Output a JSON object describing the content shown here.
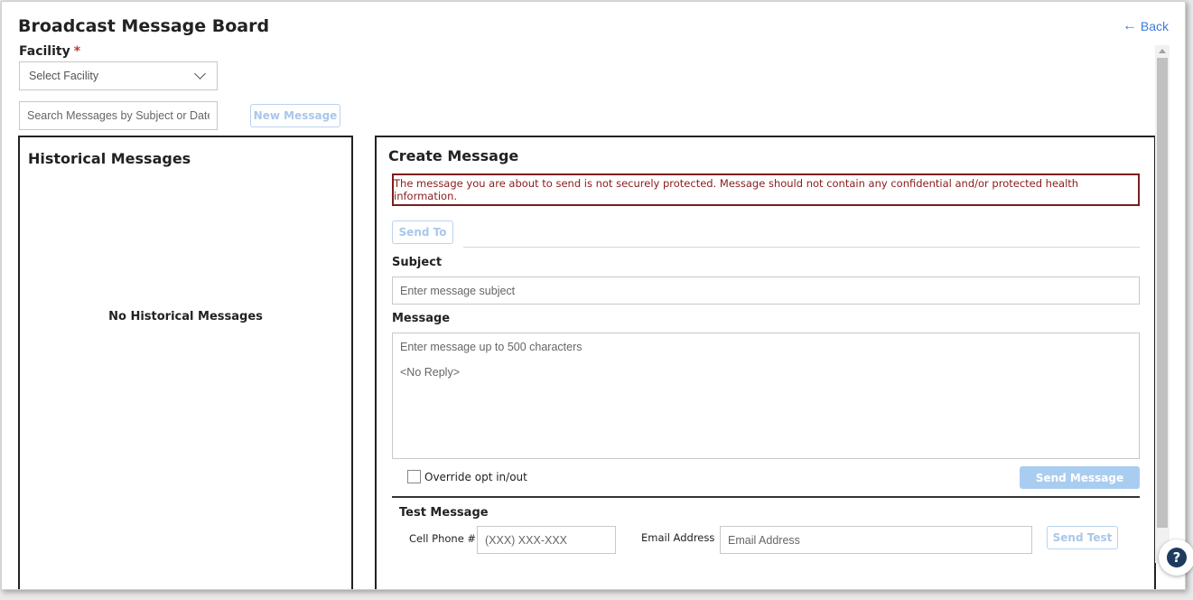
{
  "header": {
    "title": "Broadcast Message Board",
    "back_label": "Back"
  },
  "filters": {
    "facility_label": "Facility",
    "facility_required_mark": "*",
    "facility_select_value": "Select Facility",
    "search_placeholder": "Search Messages by Subject or Date",
    "new_message_label": "New Message"
  },
  "history": {
    "title": "Historical Messages",
    "empty_text": "No Historical Messages"
  },
  "create": {
    "title": "Create Message",
    "warning": "The message you are about to send is not securely protected. Message should not contain any confidential and/or protected health information.",
    "send_to_label": "Send To",
    "subject_label": "Subject",
    "subject_placeholder": "Enter message subject",
    "message_label": "Message",
    "message_placeholder": "Enter message up to 500 characters",
    "message_footer": "<No Reply>",
    "override_label": "Override opt in/out",
    "override_checked": false,
    "send_message_label": "Send Message"
  },
  "test": {
    "title": "Test Message",
    "phone_label": "Cell Phone #",
    "phone_placeholder": "(XXX) XXX-XXX",
    "email_label": "Email Address",
    "email_placeholder": "Email Address",
    "send_test_label": "Send Test"
  },
  "help": {
    "glyph": "?"
  },
  "colors": {
    "accent": "#3b7ddd",
    "warning_border": "#7a1f1f",
    "disabled_button": "#a9cdf1"
  }
}
